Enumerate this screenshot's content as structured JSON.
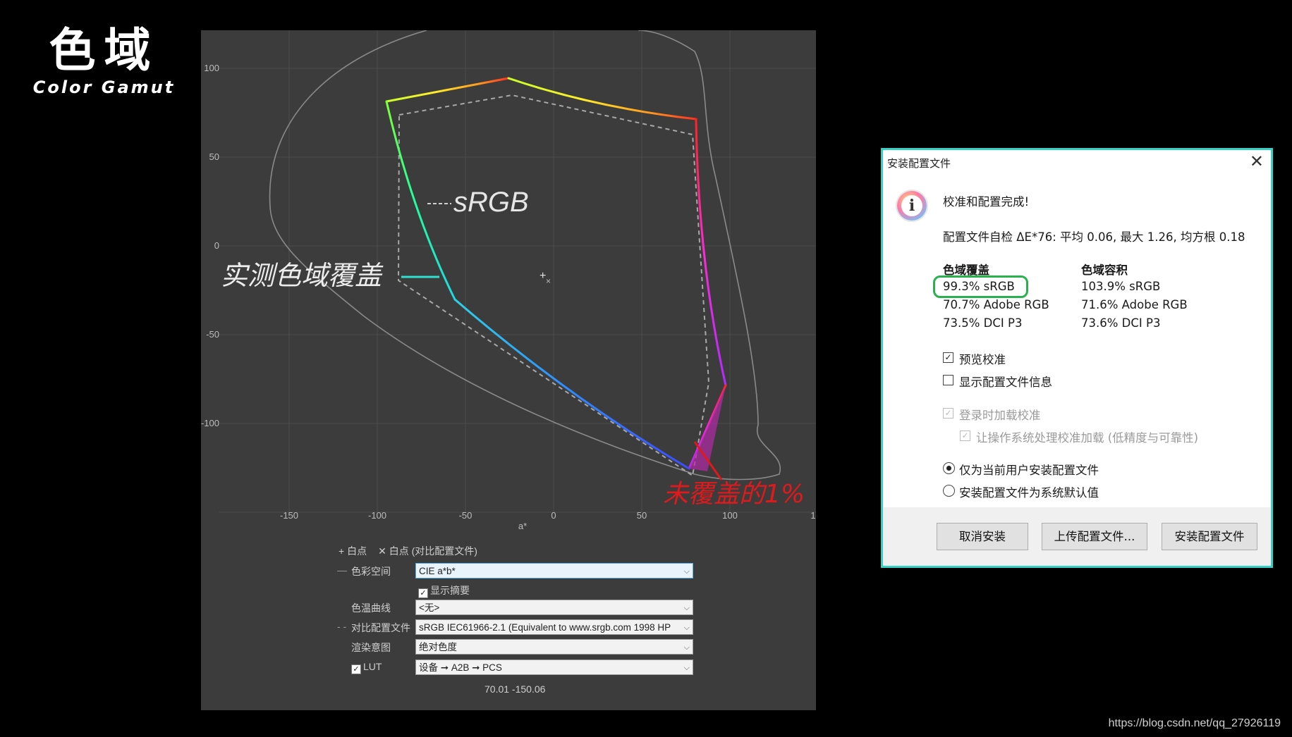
{
  "slide": {
    "title_zh": "色域",
    "title_en": "Color Gamut"
  },
  "gamut_chart": {
    "y_ticks": [
      "100",
      "50",
      "0",
      "-50",
      "-100"
    ],
    "x_ticks": [
      "-150",
      "-100",
      "-50",
      "0",
      "50",
      "100",
      "1"
    ],
    "x_axis_label": "a*",
    "annotations": {
      "srgb": "sRGB",
      "measured": "实测色域覆盖",
      "uncovered": "未覆盖的1%"
    },
    "colors": {
      "uncovered": "#e0191c",
      "measured_line": "#2ee0d0"
    }
  },
  "controls": {
    "legend_whitepoint": "白点",
    "legend_whitepoint_compare": "白点 (对比配置文件)",
    "colorspace_label": "色彩空间",
    "colorspace_value": "CIE a*b*",
    "show_summary_label": "显示摘要",
    "color_curve_label": "色温曲线",
    "color_curve_value": "<无>",
    "compare_profile_label": "对比配置文件",
    "compare_profile_value": "sRGB IEC61966-2.1 (Equivalent to www.srgb.com 1998 HP",
    "intent_label": "渲染意图",
    "intent_value": "绝对色度",
    "lut_label": "LUT",
    "lut_value": "设备 ➞ A2B ➞ PCS",
    "coords": "70.01 -150.06"
  },
  "dialog": {
    "title": "安装配置文件",
    "message": "校准和配置完成!",
    "selfcheck": "配置文件自检 ΔE*76: 平均 0.06, 最大 1.26, 均方根 0.18",
    "coverage_header": "色域覆盖",
    "coverage": [
      "99.3% sRGB",
      "70.7% Adobe RGB",
      "73.5% DCI P3"
    ],
    "volume_header": "色域容积",
    "volume": [
      "103.9% sRGB",
      "71.6% Adobe RGB",
      "73.6% DCI P3"
    ],
    "opt_preview": "预览校准",
    "opt_show_info": "显示配置文件信息",
    "opt_load_login": "登录时加载校准",
    "opt_os_load": "让操作系统处理校准加载 (低精度与可靠性)",
    "radio_current_user": "仅为当前用户安装配置文件",
    "radio_system_default": "安装配置文件为系统默认值",
    "btn_cancel": "取消安装",
    "btn_upload": "上传配置文件...",
    "btn_install": "安装配置文件"
  },
  "watermark": "https://blog.csdn.net/qq_27926119"
}
